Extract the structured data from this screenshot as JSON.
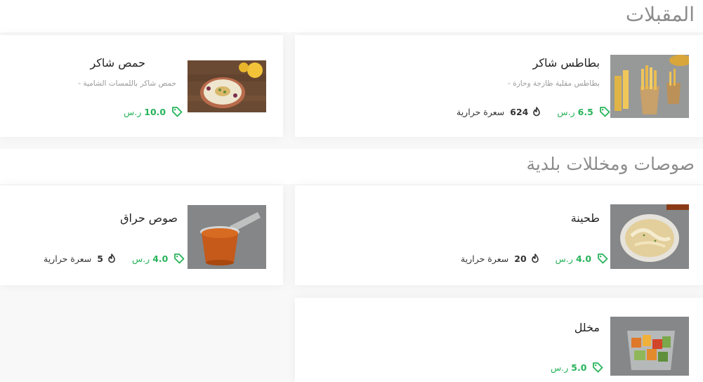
{
  "sections": [
    {
      "title": "المقبلات",
      "items": [
        {
          "name": "بطاطس شاكر",
          "description": "بطاطس مقلية طازجة وحارة -",
          "price": "6.5",
          "currency": "ر.س",
          "calories": "624",
          "calories_unit": "سعرة حرارية",
          "image_icon": "fries-image"
        },
        {
          "name": "حمص شاكر",
          "description": "حمص شاكر باللمسات الشامية -",
          "price": "10.0",
          "currency": "ر.س",
          "image_icon": "hummus-image"
        }
      ]
    },
    {
      "title": "صوصات ومخللات بلدية",
      "items": [
        {
          "name": "طحينة",
          "price": "4.0",
          "currency": "ر.س",
          "calories": "20",
          "calories_unit": "سعرة حرارية",
          "image_icon": "tahini-image"
        },
        {
          "name": "صوص حراق",
          "price": "4.0",
          "currency": "ر.س",
          "calories": "5",
          "calories_unit": "سعرة حرارية",
          "image_icon": "hot-sauce-image"
        },
        {
          "name": "مخلل",
          "price": "5.0",
          "currency": "ر.س",
          "image_icon": "pickles-image"
        }
      ]
    }
  ],
  "colors": {
    "price": "#27b35a",
    "title": "#8c8c8c",
    "text": "#222222",
    "description": "#9a9a9a"
  },
  "icons": {
    "price": "price-tag-icon",
    "calories": "flame-icon"
  }
}
